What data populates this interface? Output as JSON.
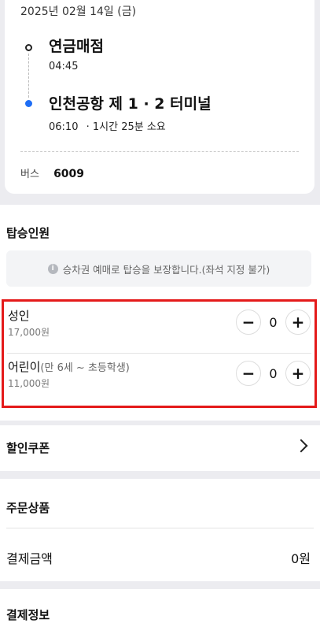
{
  "trip": {
    "date": "2025년 02월 14일 (금)",
    "departure": {
      "name": "연금매점",
      "time": "04:45"
    },
    "arrival": {
      "name": "인천공항 제 1 · 2 터미널",
      "time": "06:10",
      "duration": "· 1시간 25분 소요"
    },
    "bus_label": "버스",
    "bus_number": "6009",
    "icons": {
      "departure": "hollow-circle-dot",
      "arrival": "blue-filled-dot"
    },
    "colors": {
      "arrival_dot": "#1f6ef5"
    }
  },
  "passengers": {
    "title": "탑승인원",
    "notice": "승차권 예매로 탑승을 보장합니다.(좌석 지정 불가)",
    "notice_icon": "info-icon",
    "highlight_color": "#e41a1a",
    "adult": {
      "label": "성인",
      "price": "17,000원",
      "count": "0",
      "minus": "−",
      "plus": "+"
    },
    "child": {
      "label": "어린이",
      "note": "(만 6세 ~ 초등학생)",
      "price": "11,000원",
      "count": "0",
      "minus": "−",
      "plus": "+"
    }
  },
  "coupon": {
    "title": "할인쿠폰",
    "icon": "chevron-right-icon"
  },
  "order": {
    "title": "주문상품",
    "total_label": "결제금액",
    "total_value": "0원"
  },
  "payment": {
    "title": "결제정보"
  }
}
